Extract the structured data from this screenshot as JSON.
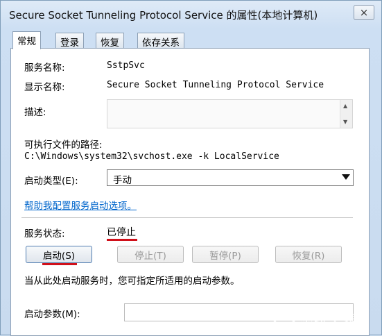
{
  "window": {
    "title": "Secure Socket Tunneling Protocol Service 的属性(本地计算机)",
    "close_label": "×"
  },
  "tabs": [
    {
      "label": "常规",
      "active": true
    },
    {
      "label": "登录",
      "active": false
    },
    {
      "label": "恢复",
      "active": false
    },
    {
      "label": "依存关系",
      "active": false
    }
  ],
  "general": {
    "service_name_label": "服务名称:",
    "service_name_value": "SstpSvc",
    "display_name_label": "显示名称:",
    "display_name_value": "Secure Socket Tunneling Protocol Service",
    "description_label": "描述:",
    "description_value": "",
    "exec_path_label": "可执行文件的路径:",
    "exec_path_value": "C:\\Windows\\system32\\svchost.exe -k LocalService",
    "startup_type_label": "启动类型(E):",
    "startup_type_value": "手动",
    "help_link": "帮助我配置服务启动选项。",
    "status_label": "服务状态:",
    "status_value": "已停止",
    "buttons": {
      "start": "启动(S)",
      "stop": "停止(T)",
      "pause": "暂停(P)",
      "resume": "恢复(R)"
    },
    "hint": "当从此处启动服务时，您可指定所适用的启动参数。",
    "start_params_label": "启动参数(M):",
    "start_params_value": ""
  },
  "colors": {
    "annotation_red": "#d0101a",
    "link_blue": "#0066cc"
  },
  "watermark": {
    "text": "系统之家"
  }
}
